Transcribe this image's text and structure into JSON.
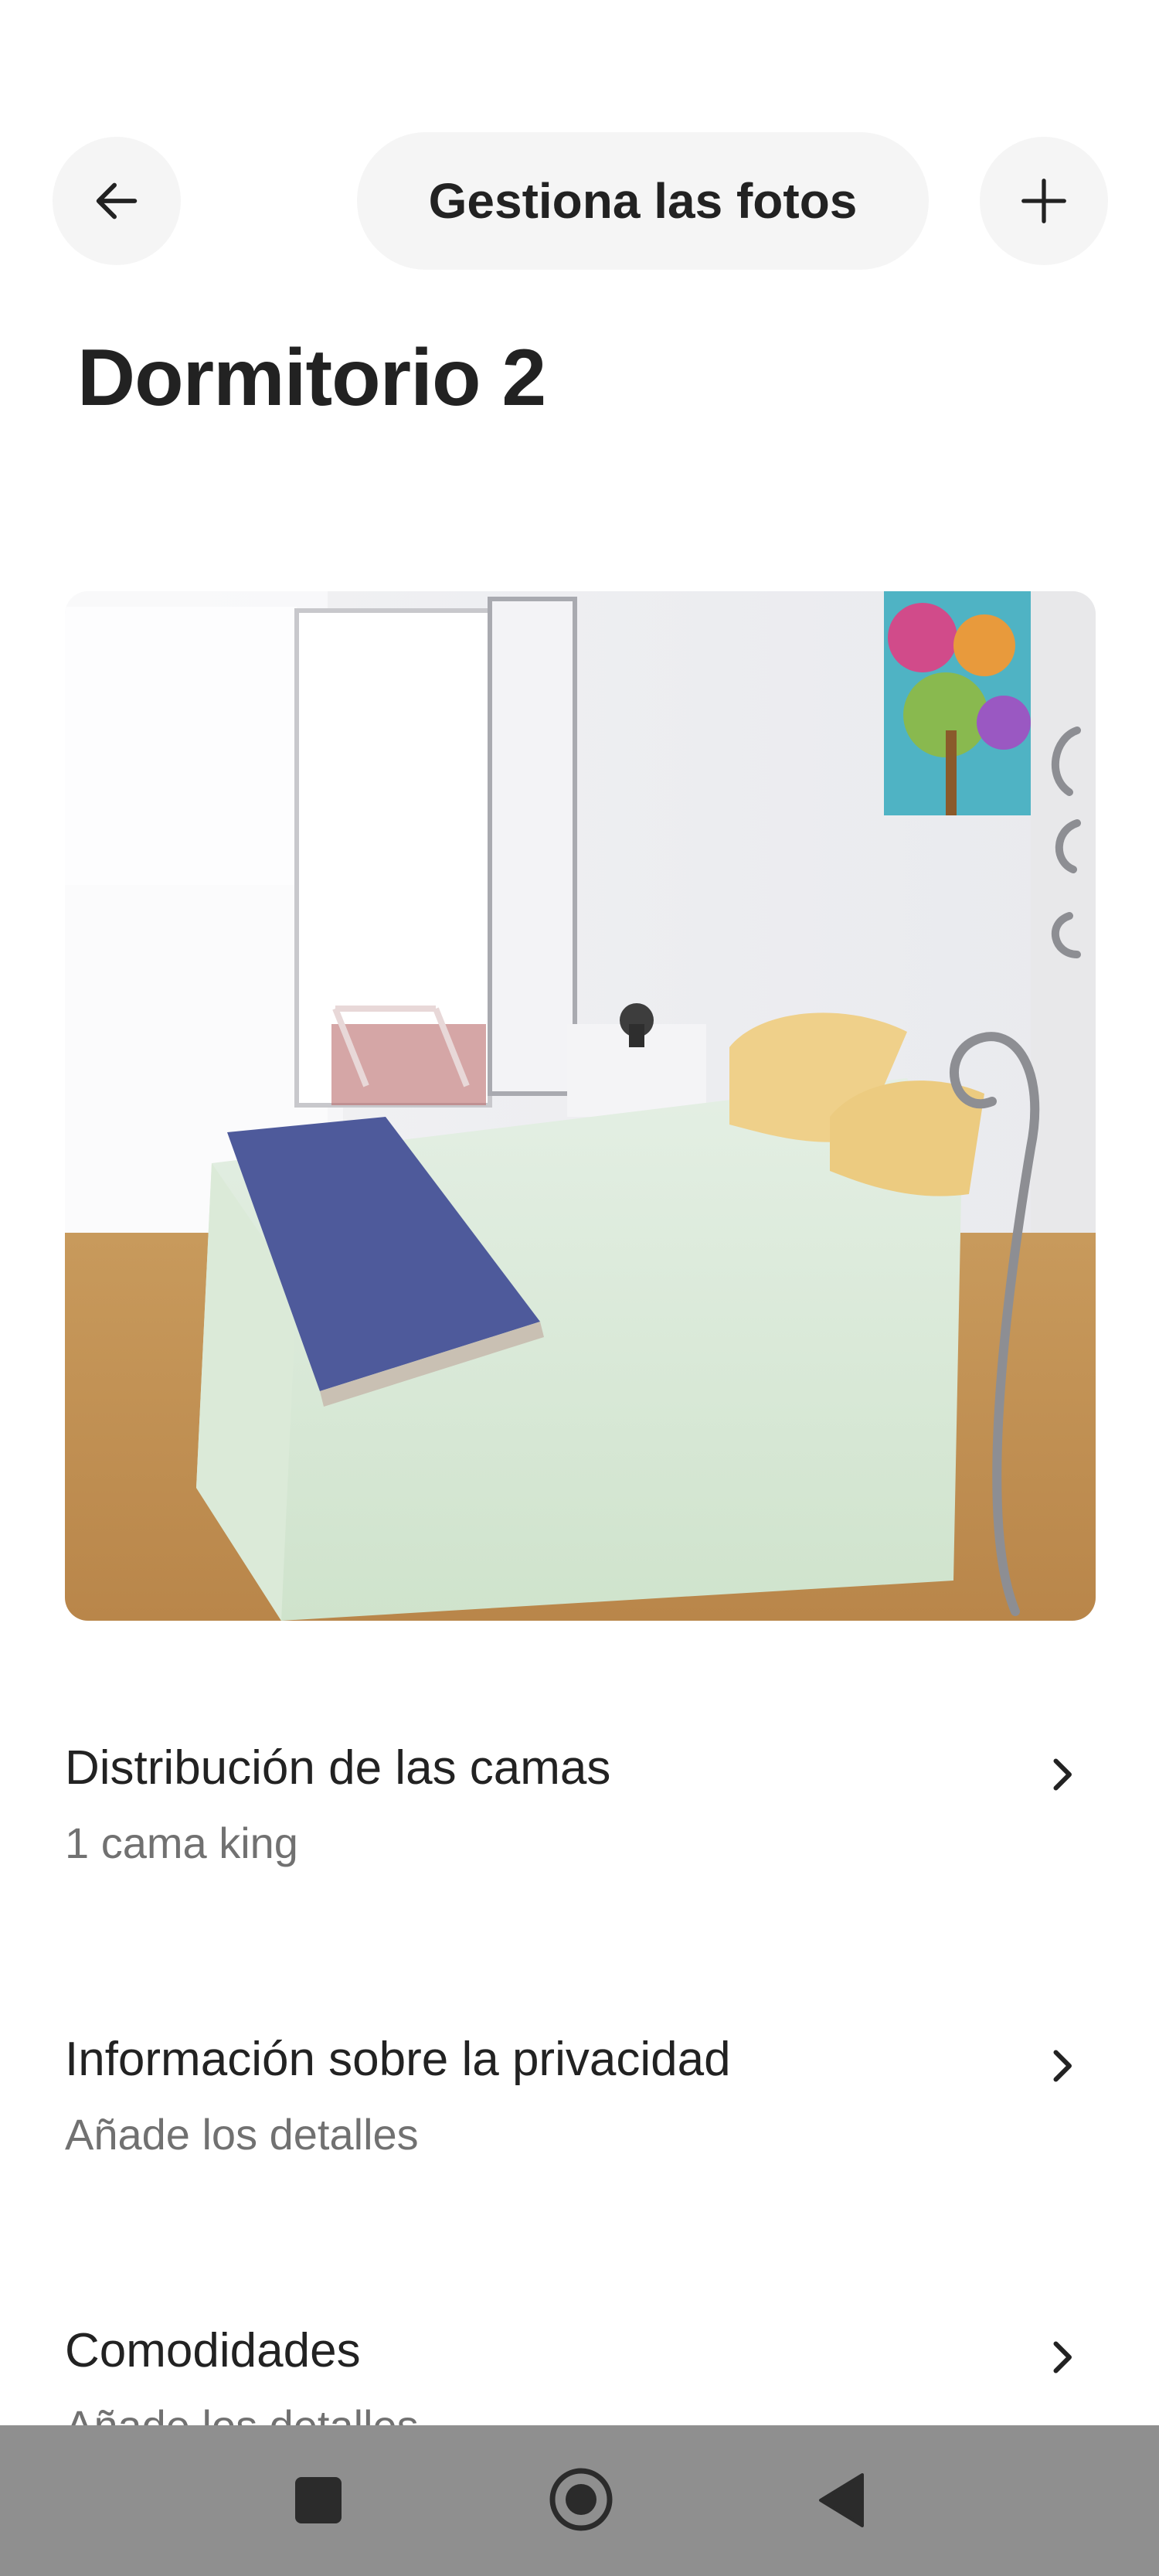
{
  "header": {
    "back_icon": "arrow-left-icon",
    "manage_label": "Gestiona las fotos",
    "add_icon": "plus-icon"
  },
  "title": "Dormitorio 2",
  "photo": {
    "alt": "bedroom-photo"
  },
  "rows": [
    {
      "title": "Distribución de las camas",
      "subtitle": "1 cama king",
      "icon": "chevron-right-icon"
    },
    {
      "title": "Información sobre la privacidad",
      "subtitle": "Añade los detalles",
      "icon": "chevron-right-icon"
    },
    {
      "title": "Comodidades",
      "subtitle": "Añade los detalles",
      "icon": "chevron-right-icon"
    }
  ],
  "navbar": {
    "recents_icon": "square-recents-icon",
    "home_icon": "circle-home-icon",
    "back_icon": "triangle-back-icon",
    "color": "#8f8f8f"
  }
}
